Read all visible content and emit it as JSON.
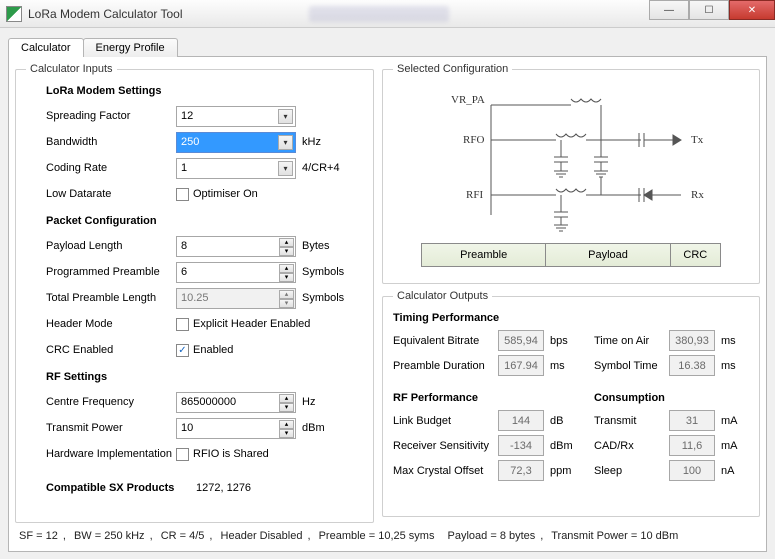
{
  "window": {
    "title": "LoRa Modem Calculator Tool"
  },
  "tabs": {
    "calculator": "Calculator",
    "energy": "Energy Profile"
  },
  "inputs": {
    "legend": "Calculator Inputs",
    "modem_header": "LoRa Modem Settings",
    "sf_label": "Spreading Factor",
    "sf_value": "12",
    "bw_label": "Bandwidth",
    "bw_value": "250",
    "bw_unit": "kHz",
    "cr_label": "Coding Rate",
    "cr_value": "1",
    "cr_unit": "4/CR+4",
    "ldr_label": "Low Datarate",
    "ldr_box": "Optimiser On",
    "pkt_header": "Packet Configuration",
    "pl_label": "Payload Length",
    "pl_value": "8",
    "pl_unit": "Bytes",
    "pp_label": "Programmed Preamble",
    "pp_value": "6",
    "pp_unit": "Symbols",
    "tpl_label": "Total Preamble Length",
    "tpl_value": "10.25",
    "tpl_unit": "Symbols",
    "hm_label": "Header Mode",
    "hm_box": "Explicit Header Enabled",
    "crc_label": "CRC Enabled",
    "crc_box": "Enabled",
    "crc_checked": true,
    "rf_header": "RF Settings",
    "cf_label": "Centre Frequency",
    "cf_value": "865000000",
    "cf_unit": "Hz",
    "tp_label": "Transmit Power",
    "tp_value": "10",
    "tp_unit": "dBm",
    "hw_label": "Hardware Implementation",
    "hw_box": "RFIO is Shared",
    "compat_header": "Compatible SX Products",
    "compat_value": "1272, 1276"
  },
  "selected": {
    "legend": "Selected Configuration",
    "nodes": {
      "vrpa": "VR_PA",
      "rfo": "RFO",
      "rfi": "RFI",
      "tx": "Tx",
      "rx": "Rx"
    },
    "seg": {
      "preamble": "Preamble",
      "payload": "Payload",
      "crc": "CRC"
    }
  },
  "outputs": {
    "legend": "Calculator Outputs",
    "timing_header": "Timing Performance",
    "eq_label": "Equivalent Bitrate",
    "eq_value": "585,94",
    "eq_unit": "bps",
    "toa_label": "Time on Air",
    "toa_value": "380,93",
    "toa_unit": "ms",
    "pd_label": "Preamble Duration",
    "pd_value": "167.94",
    "pd_unit": "ms",
    "st_label": "Symbol Time",
    "st_value": "16.38",
    "st_unit": "ms",
    "rf_header": "RF Performance",
    "lb_label": "Link Budget",
    "lb_value": "144",
    "lb_unit": "dB",
    "rs_label": "Receiver Sensitivity",
    "rs_value": "-134",
    "rs_unit": "dBm",
    "mco_label": "Max Crystal Offset",
    "mco_value": "72,3",
    "mco_unit": "ppm",
    "cons_header": "Consumption",
    "ctx_label": "Transmit",
    "ctx_value": "31",
    "ctx_unit": "mA",
    "crx_label": "CAD/Rx",
    "crx_value": "11,6",
    "crx_unit": "mA",
    "csl_label": "Sleep",
    "csl_value": "100",
    "csl_unit": "nA"
  },
  "status": {
    "sf": "SF = 12",
    "bw": "BW = 250 kHz",
    "cr": "CR = 4/5",
    "hdr": "Header Disabled",
    "pre": "Preamble = 10,25 syms",
    "pl": "Payload = 8 bytes",
    "tp": "Transmit Power = 10 dBm"
  },
  "chart_data": {
    "type": "table",
    "title": "LoRa Link Calculator — current state",
    "inputs": {
      "spreading_factor": 12,
      "bandwidth_khz": 250,
      "coding_rate_index": 1,
      "coding_rate_str": "4/5",
      "low_datarate_optimiser": false,
      "payload_length_bytes": 8,
      "programmed_preamble_symbols": 6,
      "total_preamble_symbols": 10.25,
      "explicit_header": false,
      "crc_enabled": true,
      "centre_frequency_hz": 865000000,
      "transmit_power_dbm": 10,
      "rfio_shared": false,
      "compatible_sx": [
        1272,
        1276
      ]
    },
    "outputs": {
      "equivalent_bitrate_bps": 585.94,
      "preamble_duration_ms": 167.94,
      "time_on_air_ms": 380.93,
      "symbol_time_ms": 16.38,
      "link_budget_db": 144,
      "receiver_sensitivity_dbm": -134,
      "max_crystal_offset_ppm": 72.3,
      "consumption_transmit_ma": 31,
      "consumption_cad_rx_ma": 11.6,
      "consumption_sleep_na": 100
    }
  }
}
